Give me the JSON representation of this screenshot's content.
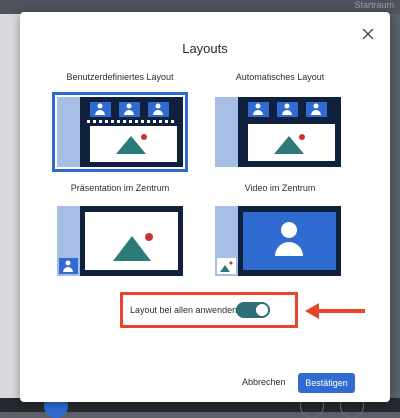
{
  "background": {
    "top_right_text": "Startraum"
  },
  "dialog": {
    "title": "Layouts",
    "layouts": [
      {
        "label": "Benutzerdefiniertes Layout",
        "selected": true
      },
      {
        "label": "Automatisches Layout",
        "selected": false
      },
      {
        "label": "Präsentation im Zentrum",
        "selected": false
      },
      {
        "label": "Video im Zentrum",
        "selected": false
      }
    ],
    "apply_all": {
      "label": "Layout bei allen anwenden",
      "enabled": true
    },
    "cancel_label": "Abbrechen",
    "confirm_label": "Bestätigen"
  },
  "colors": {
    "accent": "#2f6bd1",
    "toggle_on": "#2f6f7a",
    "highlight": "#e8452b",
    "thumb_dark": "#10213d",
    "thumb_side": "#a7bfe6"
  }
}
